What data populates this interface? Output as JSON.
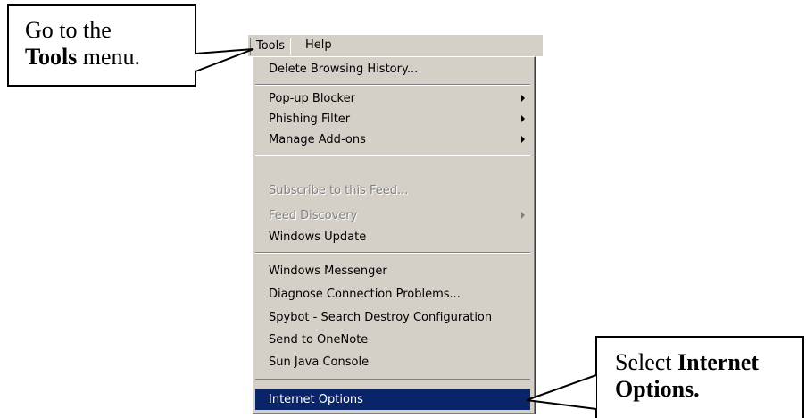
{
  "menubar": {
    "items": [
      {
        "label": "Tools"
      },
      {
        "label": "Help"
      }
    ]
  },
  "tools_menu": {
    "items": [
      {
        "label": "Delete Browsing History...",
        "enabled": true,
        "submenu": false
      },
      {
        "label": "Pop-up Blocker",
        "enabled": true,
        "submenu": true
      },
      {
        "label": "Phishing Filter",
        "enabled": true,
        "submenu": true
      },
      {
        "label": "Manage Add-ons",
        "enabled": true,
        "submenu": true
      },
      {
        "label": "Subscribe to this Feed...",
        "enabled": false,
        "submenu": false
      },
      {
        "label": "Feed Discovery",
        "enabled": false,
        "submenu": true
      },
      {
        "label": "Windows Update",
        "enabled": true,
        "submenu": false
      },
      {
        "label": "Windows Messenger",
        "enabled": true,
        "submenu": false
      },
      {
        "label": "Diagnose Connection Problems...",
        "enabled": true,
        "submenu": false
      },
      {
        "label": "Spybot - Search  Destroy Configuration",
        "enabled": true,
        "submenu": false
      },
      {
        "label": "Send to OneNote",
        "enabled": true,
        "submenu": false
      },
      {
        "label": "Sun Java Console",
        "enabled": true,
        "submenu": false
      },
      {
        "label": "Internet Options",
        "enabled": true,
        "submenu": false,
        "highlighted": true
      }
    ]
  },
  "callouts": {
    "tools": {
      "line1": "Go to the",
      "bold": "Tools",
      "rest": " menu."
    },
    "internet_options": {
      "prefix": "Select ",
      "bold1": "Internet",
      "bold2": "Options."
    }
  },
  "colors": {
    "menu_background": "#d4d0c8",
    "highlight_background": "#0a246a",
    "highlight_text": "#ffffff",
    "disabled_text": "#808080"
  }
}
